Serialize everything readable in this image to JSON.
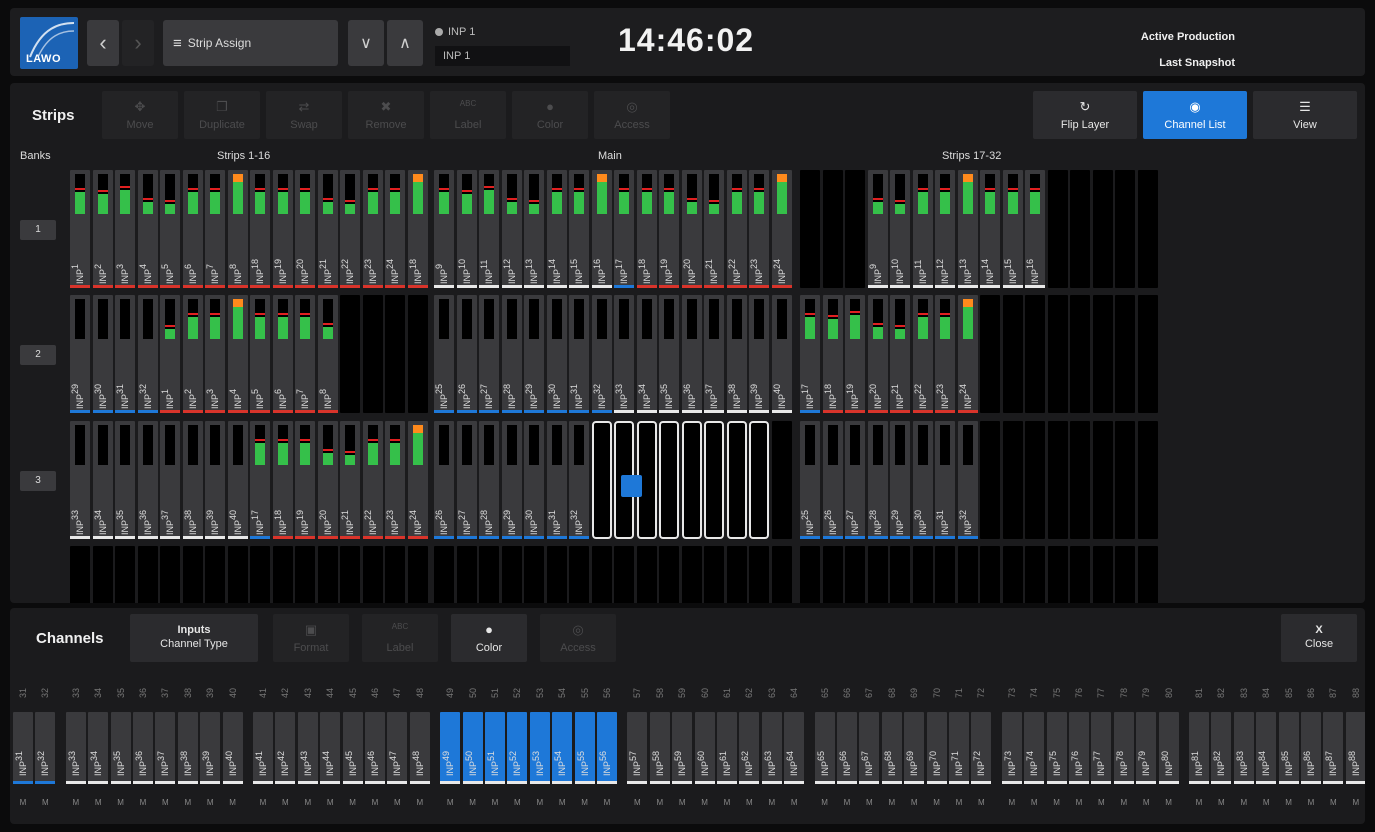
{
  "topbar": {
    "logo_text": "LAWO",
    "menu_label": "Strip Assign",
    "inp_top": "INP  1",
    "inp_bottom": "INP  1",
    "clock": "14:46:02",
    "production": "Active Production",
    "snapshot": "Last Snapshot",
    "icons": [
      "chevron-left-icon",
      "chevron-right-icon",
      "menu-icon",
      "chevron-down-icon",
      "chevron-up-icon"
    ]
  },
  "strips": {
    "title": "Strips",
    "tools": [
      "Move",
      "Duplicate",
      "Swap",
      "Remove",
      "Label",
      "Color",
      "Access"
    ],
    "right_tools": [
      "Flip Layer",
      "Channel List",
      "View"
    ],
    "banks_label": "Banks",
    "sections": [
      "Strips 1-16",
      "Main",
      "Strips 17-32"
    ],
    "bank_buttons": [
      "1",
      "2",
      "3"
    ],
    "prefix": "INP",
    "rows": [
      {
        "left": [
          1,
          2,
          3,
          4,
          5,
          6,
          7,
          8,
          18,
          19,
          20,
          21,
          22,
          23,
          24,
          18
        ],
        "main": [
          9,
          10,
          11,
          12,
          13,
          14,
          15,
          16,
          17,
          18,
          19,
          20,
          21,
          22,
          23,
          24
        ],
        "right": [
          9,
          10,
          11,
          12,
          13,
          14,
          15,
          16
        ]
      },
      {
        "left": [
          29,
          30,
          31,
          32,
          1,
          2,
          3,
          4,
          5,
          6,
          7,
          8
        ],
        "main": [
          25,
          26,
          27,
          28,
          29,
          30,
          31,
          32,
          33,
          34,
          35,
          36,
          37,
          38,
          39,
          40
        ],
        "right": [
          17,
          18,
          19,
          20,
          21,
          22,
          23,
          24
        ]
      },
      {
        "left": [
          33,
          34,
          35,
          36,
          37,
          38,
          39,
          40,
          17,
          18,
          19,
          20,
          21,
          22,
          23,
          24
        ],
        "main": [
          26,
          27,
          28,
          29,
          30,
          31,
          32
        ],
        "right": [
          25,
          26,
          27,
          28,
          29,
          30,
          31,
          32
        ]
      }
    ],
    "colors": {
      "red": "#d9342b",
      "blue": "#1e78d8",
      "white": "#e8e8e8",
      "green": "#35c04a",
      "orange": "#ff8a1c",
      "accent": "#1e78d8"
    }
  },
  "channels": {
    "title": "Channels",
    "type_value": "Inputs",
    "type_label": "Channel Type",
    "tools": [
      "Format",
      "Label",
      "Color",
      "Access"
    ],
    "close_x": "X",
    "close_label": "Close",
    "prefix": "INP",
    "mute_label": "M",
    "numbers": [
      31,
      32,
      33,
      34,
      35,
      36,
      37,
      38,
      39,
      40,
      41,
      42,
      43,
      44,
      45,
      46,
      47,
      48,
      49,
      50,
      51,
      52,
      53,
      54,
      55,
      56,
      57,
      58,
      59,
      60,
      61,
      62,
      63,
      64,
      65,
      66,
      67,
      68,
      69,
      70,
      71,
      72,
      73,
      74,
      75,
      76,
      77,
      78,
      79,
      80,
      81,
      82,
      83,
      84,
      85,
      86,
      87,
      88
    ],
    "selected": [
      49,
      50,
      51,
      52,
      53,
      54,
      55,
      56
    ]
  }
}
